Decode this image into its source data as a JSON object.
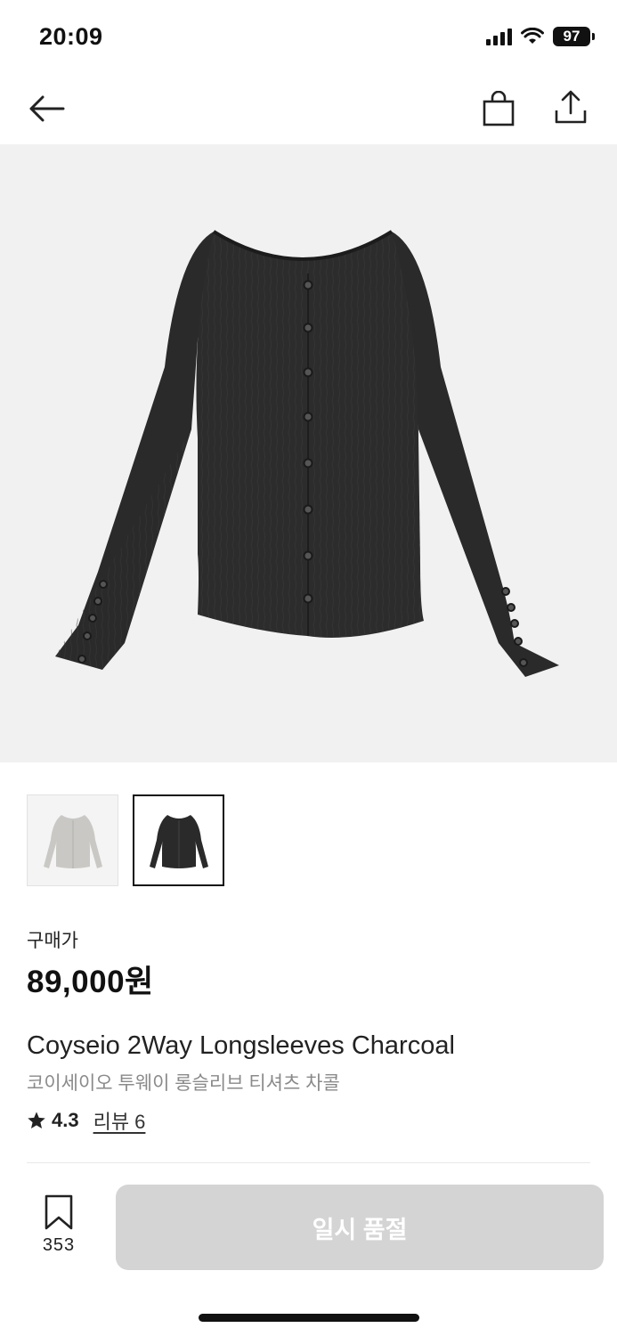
{
  "status_bar": {
    "time": "20:09",
    "battery": "97",
    "icons": [
      "signal-icon",
      "wifi-icon",
      "battery-icon"
    ]
  },
  "nav": {
    "icons": [
      "back-arrow-icon",
      "shopping-bag-icon",
      "share-icon"
    ]
  },
  "product": {
    "price_label": "구매가",
    "price": "89,000원",
    "name_en": "Coyseio 2Way Longsleeves Charcoal",
    "name_ko": "코이세이오 투웨이 롱슬리브 티셔츠 차콜",
    "rating": "4.3",
    "review_link": "리뷰 6",
    "colors": {
      "charcoal": "#2a2a2a",
      "gray": "#c9c8c4",
      "background": "#f1f1f1"
    }
  },
  "thumbnails": [
    {
      "label": "gray-variant",
      "selected": false
    },
    {
      "label": "charcoal-variant",
      "selected": true
    }
  ],
  "bottom_bar": {
    "bookmark_count": "353",
    "button_label": "일시 품절"
  }
}
